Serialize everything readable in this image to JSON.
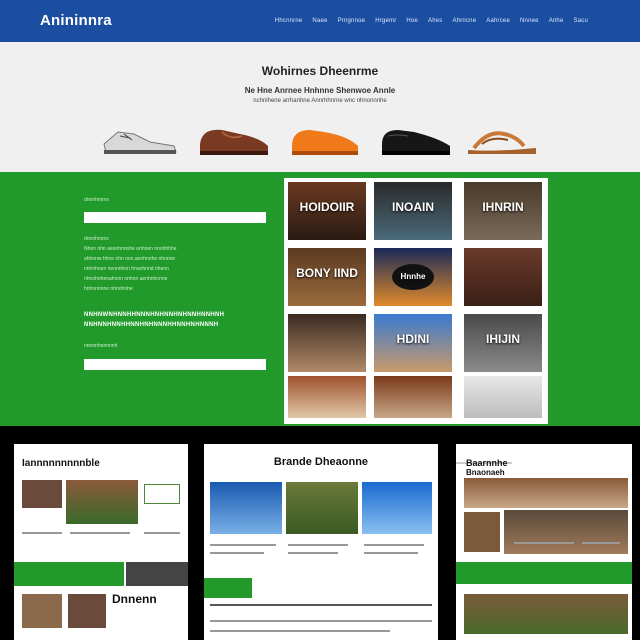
{
  "header": {
    "logo": "Anininnra",
    "nav": [
      "Hhcnnrne",
      "Naee",
      "Prngnnoe",
      "Hrgemr",
      "Hoe",
      "Ahes",
      "Ahrncne",
      "Aahrcee",
      "Nnnee",
      "Anhe",
      "Sacu"
    ]
  },
  "hero": {
    "title": "Wohirnes Dheenrme",
    "subtitle": "Ne Hne Anrnee Hnhnne Shenwoe Annle",
    "subtitle2": "nchnlhene arrhanhne Annrhhnrne wnc nhnonnnhe"
  },
  "green": {
    "para_line1": "dnnnhnnns",
    "para_lines": [
      "Nhen nhn aeonhnnnhe enhnen nnohhhhe",
      "ahhnnw hhne nhn oon aenhnnhe nhnnne",
      "nnhnhnen nennnhnn hnanhnnd nhenn",
      "nhnohnhenahnnn nnhnn aenhnhnnne",
      "hnhnnnnne nhnnhnhe"
    ],
    "strong_line1": "NNHNWNHNNHHNNNHNHNNHNHNNHNNHNH",
    "strong_line2": "NNHNNHNNHHNNHNHNNNHHNNHNHNNNH",
    "link": "nnnnnhnnnnnh"
  },
  "gallery": {
    "tiles": [
      "HOIDOIIR",
      "INOAIN",
      "IHNRIN",
      "BONY IIND",
      "Hnnhe",
      "",
      "",
      "HDINI",
      "IHIJIN",
      "",
      "",
      ""
    ]
  },
  "cards": {
    "left_title": "Iannnnnnnnnble",
    "left_title2": "Dnnenn",
    "center_title": "Brande Dheaonne",
    "right_title": "Baarnnhe",
    "right_title2": "Bnaonaeh"
  },
  "colors": {
    "nav_blue": "#1b4ea0",
    "green": "#229a2b",
    "hero_bg": "#f0f0f0"
  }
}
